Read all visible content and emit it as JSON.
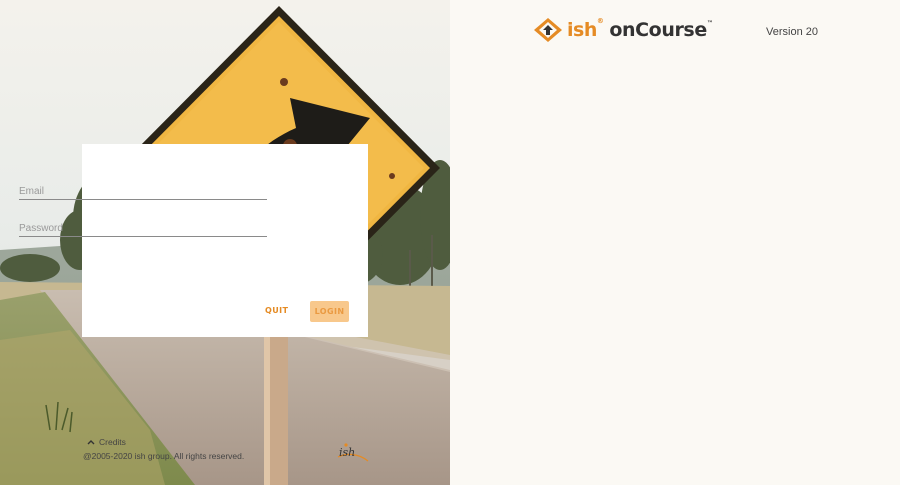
{
  "brand": {
    "name_ish": "ish",
    "reg": "®",
    "name_product": "onCourse",
    "tm": "™"
  },
  "version": "Version 20",
  "login_form": {
    "email_placeholder": "Email",
    "password_placeholder": "Password",
    "quit_label": "QUIT",
    "login_label": "LOGIN"
  },
  "footer": {
    "credits_label": "Credits",
    "copyright": "@2005-2020 ish group. All rights reserved.",
    "footer_logo_text": "ish"
  },
  "colors": {
    "accent": "#e58b24",
    "login_bg": "#f8c88c",
    "sign_yellow": "#f0b642"
  }
}
